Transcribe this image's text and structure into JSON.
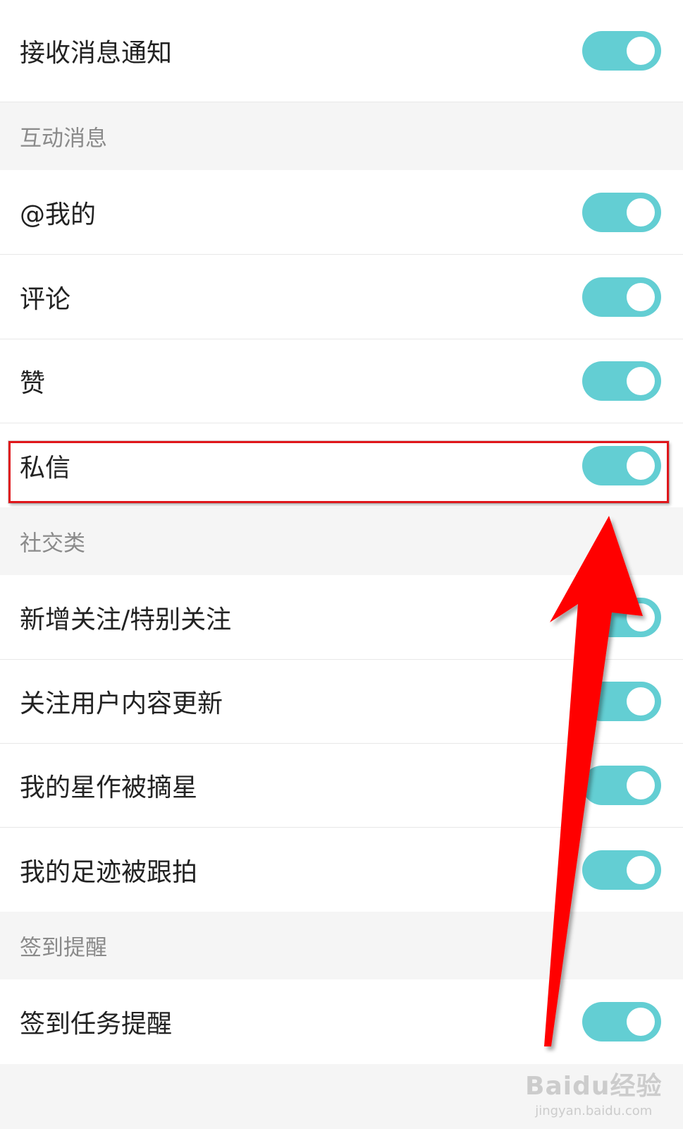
{
  "master": {
    "label": "接收消息通知",
    "toggle": "on"
  },
  "sections": {
    "interaction": "互动消息",
    "social": "社交类",
    "checkin": "签到提醒"
  },
  "items": {
    "mention": {
      "label": "@我的",
      "toggle": "on"
    },
    "comment": {
      "label": "评论",
      "toggle": "on"
    },
    "like": {
      "label": "赞",
      "toggle": "on"
    },
    "dm": {
      "label": "私信",
      "toggle": "on"
    },
    "follow": {
      "label": "新增关注/特别关注",
      "toggle": "on"
    },
    "followed_updates": {
      "label": "关注用户内容更新",
      "toggle": "on"
    },
    "star_picked": {
      "label": "我的星作被摘星",
      "toggle": "on"
    },
    "footprint_followed": {
      "label": "我的足迹被跟拍",
      "toggle": "on"
    },
    "checkin_task": {
      "label": "签到任务提醒",
      "toggle": "on"
    }
  },
  "colors": {
    "toggle_on": "#63ced3",
    "highlight": "#e0161b",
    "arrow": "#ff0000"
  },
  "watermark": {
    "main": "Baidu经验",
    "sub": "jingyan.baidu.com"
  }
}
